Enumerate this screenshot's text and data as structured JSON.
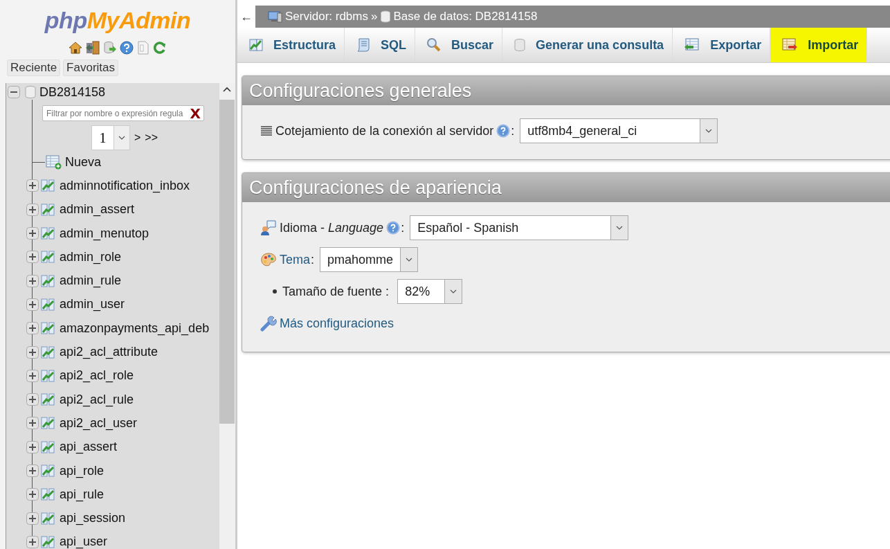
{
  "sidebar": {
    "logo": {
      "php": "php",
      "brand": "MyAdmin"
    },
    "tabs": [
      {
        "label": "Reciente"
      },
      {
        "label": "Favoritas"
      }
    ],
    "tree": {
      "database": {
        "label": "DB2814158",
        "expanded": true
      },
      "filter": {
        "placeholder": "Filtrar por nombre o expresión regula",
        "clear": "X"
      },
      "pager": {
        "page": "1",
        "next": ">",
        "last": ">>"
      },
      "new_item": {
        "label": "Nueva"
      },
      "tables": [
        {
          "label": "adminnotification_inbox",
          "expanded": false
        },
        {
          "label": "admin_assert",
          "expanded": false
        },
        {
          "label": "admin_menutop",
          "expanded": false
        },
        {
          "label": "admin_role",
          "expanded": false
        },
        {
          "label": "admin_rule",
          "expanded": false
        },
        {
          "label": "admin_user",
          "expanded": false
        },
        {
          "label": "amazonpayments_api_deb",
          "expanded": false
        },
        {
          "label": "api2_acl_attribute",
          "expanded": false
        },
        {
          "label": "api2_acl_role",
          "expanded": false
        },
        {
          "label": "api2_acl_rule",
          "expanded": false
        },
        {
          "label": "api2_acl_user",
          "expanded": false
        },
        {
          "label": "api_assert",
          "expanded": false
        },
        {
          "label": "api_role",
          "expanded": false
        },
        {
          "label": "api_rule",
          "expanded": false
        },
        {
          "label": "api_session",
          "expanded": false
        },
        {
          "label": "api_user",
          "expanded": false
        }
      ]
    }
  },
  "breadcrumb": {
    "back": "←",
    "server": "Servidor: rdbms",
    "separator": "»",
    "database": "Base de datos: DB2814158"
  },
  "tabs": [
    {
      "label": "Estructura",
      "kind": "structure",
      "highlighted": false
    },
    {
      "label": "SQL",
      "kind": "sql",
      "highlighted": false
    },
    {
      "label": "Buscar",
      "kind": "search",
      "highlighted": false
    },
    {
      "label": "Generar una consulta",
      "kind": "query",
      "highlighted": false
    },
    {
      "label": "Exportar",
      "kind": "export",
      "highlighted": false
    },
    {
      "label": "Importar",
      "kind": "import",
      "highlighted": true
    }
  ],
  "panels": [
    {
      "title": "Configuraciones generales",
      "rows": [
        {
          "kind": "select",
          "label": "Cotejamiento de la conexión al servidor",
          "help": true,
          "suffix": ":",
          "value": "utf8mb4_general_ci",
          "link": false
        }
      ]
    },
    {
      "title": "Configuraciones de apariencia",
      "rows": [
        {
          "kind": "select",
          "label": "Idioma - *Language*",
          "help": true,
          "suffix": ":",
          "value": "Español - Spanish",
          "link": false
        },
        {
          "kind": "select",
          "label": "Tema",
          "help": false,
          "suffix": ":",
          "value": "pmahomme",
          "link": true
        },
        {
          "kind": "bullet-select",
          "label": "Tamaño de fuente",
          "help": false,
          "suffix": ":",
          "value": "82%",
          "link": false
        },
        {
          "kind": "link",
          "label": "Más configuraciones",
          "link": true
        }
      ]
    }
  ]
}
